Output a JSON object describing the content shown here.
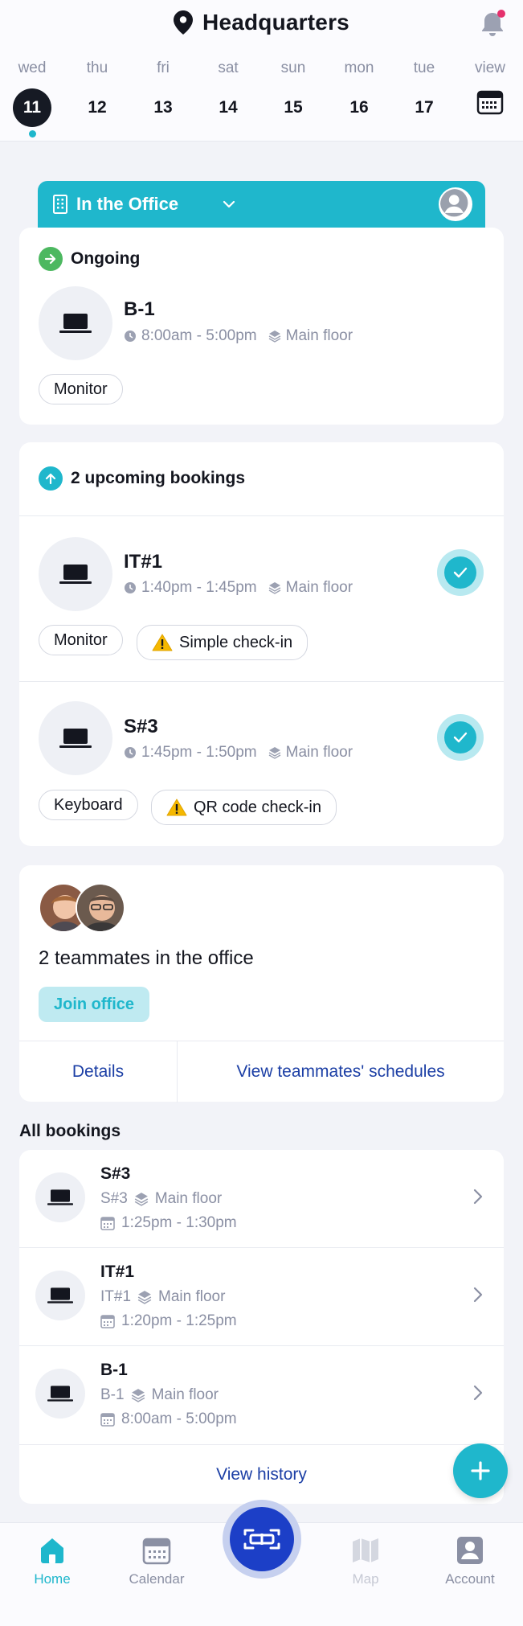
{
  "header": {
    "title": "Headquarters",
    "notification_unread": true
  },
  "days": [
    {
      "name": "wed",
      "num": "11",
      "active": true
    },
    {
      "name": "thu",
      "num": "12"
    },
    {
      "name": "fri",
      "num": "13"
    },
    {
      "name": "sat",
      "num": "14"
    },
    {
      "name": "sun",
      "num": "15"
    },
    {
      "name": "mon",
      "num": "16"
    },
    {
      "name": "tue",
      "num": "17"
    },
    {
      "name": "view",
      "icon": "calendar-icon"
    }
  ],
  "office": {
    "status_label": "In the Office"
  },
  "ongoing": {
    "heading": "Ongoing",
    "booking": {
      "name": "B-1",
      "time": "8:00am - 5:00pm",
      "floor": "Main floor",
      "tags": [
        "Monitor"
      ]
    }
  },
  "upcoming": {
    "heading": "2 upcoming bookings",
    "bookings": [
      {
        "name": "IT#1",
        "time": "1:40pm - 1:45pm",
        "floor": "Main floor",
        "tag": "Monitor",
        "checkin": "Simple check-in"
      },
      {
        "name": "S#3",
        "time": "1:45pm - 1:50pm",
        "floor": "Main floor",
        "tag": "Keyboard",
        "checkin": "QR code check-in"
      }
    ]
  },
  "team": {
    "text": "2 teammates in the office",
    "join_label": "Join office",
    "details_label": "Details",
    "schedules_label": "View teammates' schedules"
  },
  "all_bookings": {
    "title": "All bookings",
    "items": [
      {
        "name": "S#3",
        "sub": "S#3",
        "floor": "Main floor",
        "time": "1:25pm - 1:30pm"
      },
      {
        "name": "IT#1",
        "sub": "IT#1",
        "floor": "Main floor",
        "time": "1:20pm - 1:25pm"
      },
      {
        "name": "B-1",
        "sub": "B-1",
        "floor": "Main floor",
        "time": "8:00am - 5:00pm"
      }
    ],
    "view_history_label": "View history"
  },
  "nav": {
    "home": "Home",
    "calendar": "Calendar",
    "map": "Map",
    "account": "Account"
  },
  "colors": {
    "accent": "#1fb7cc",
    "primary_blue": "#1c3fa5",
    "ongoing_green": "#4cb860",
    "notification_red": "#e5316d"
  }
}
